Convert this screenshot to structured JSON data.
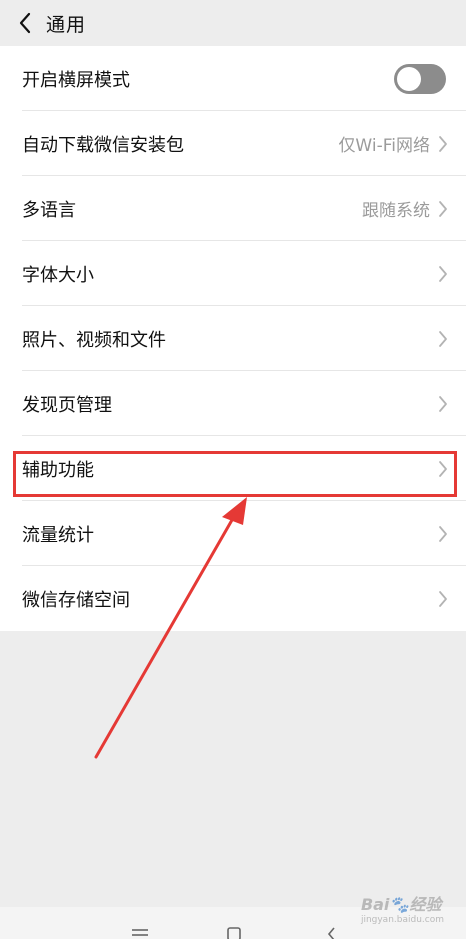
{
  "header": {
    "title": "通用"
  },
  "rows": [
    {
      "label": "开启横屏模式",
      "value": "",
      "type": "toggle",
      "toggle_on": false
    },
    {
      "label": "自动下载微信安装包",
      "value": "仅Wi-Fi网络",
      "type": "nav"
    },
    {
      "label": "多语言",
      "value": "跟随系统",
      "type": "nav"
    },
    {
      "label": "字体大小",
      "value": "",
      "type": "nav"
    },
    {
      "label": "照片、视频和文件",
      "value": "",
      "type": "nav"
    },
    {
      "label": "发现页管理",
      "value": "",
      "type": "nav"
    },
    {
      "label": "辅助功能",
      "value": "",
      "type": "nav",
      "highlighted": true
    },
    {
      "label": "流量统计",
      "value": "",
      "type": "nav"
    },
    {
      "label": "微信存储空间",
      "value": "",
      "type": "nav"
    }
  ],
  "watermark": {
    "brand": "Bai",
    "suffix": "经验",
    "url": "jingyan.baidu.com"
  },
  "colors": {
    "highlight": "#e53935",
    "toggle_off": "#8c8c8c",
    "secondary_text": "#9b9b9b"
  }
}
